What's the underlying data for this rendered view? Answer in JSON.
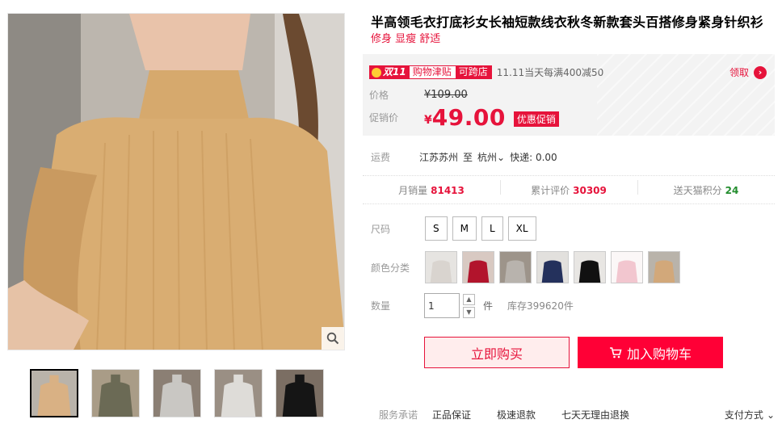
{
  "product": {
    "title": "半高领毛衣打底衫女长袖短款线衣秋冬新款套头百搭修身紧身针织衫",
    "subtitle": "修身 显瘦 舒适"
  },
  "promo": {
    "badge_mark": "双11",
    "badge_text": "购物津贴",
    "badge_tag": "可跨店",
    "text": "11.11当天每满400减50",
    "claim_label": "领取",
    "claim_icon": "chevron-right-circle-icon"
  },
  "price": {
    "list_label": "价格",
    "list_value": "¥109.00",
    "sale_label": "促销价",
    "currency": "¥",
    "sale_value": "49.00",
    "sale_tag": "优惠促销"
  },
  "shipping": {
    "label": "运费",
    "from": "江苏苏州",
    "to_word": "至",
    "to": "杭州",
    "method": "快递: 0.00"
  },
  "stats": {
    "monthly_label": "月销量",
    "monthly_value": "81413",
    "reviews_label": "累计评价",
    "reviews_value": "30309",
    "points_label": "送天猫积分",
    "points_value": "24"
  },
  "options": {
    "size_label": "尺码",
    "sizes": [
      "S",
      "M",
      "L",
      "XL"
    ],
    "color_label": "颜色分类",
    "qty_label": "数量",
    "qty_value": "1",
    "unit": "件",
    "stock": "库存399620件"
  },
  "actions": {
    "buy_now": "立即购买",
    "add_cart": "加入购物车"
  },
  "services": {
    "label": "服务承诺",
    "items": [
      "正品保证",
      "极速退款",
      "七天无理由退换"
    ],
    "payment": "支付方式"
  },
  "colors": {
    "accent": "#e6133b",
    "cart_button": "#ff0036",
    "green": "#238d2e",
    "swatches": [
      "#d9d4cf",
      "#b2142c",
      "#b8b3ad",
      "#24315c",
      "#111111",
      "#f2c6cf",
      "#d2a87a"
    ]
  },
  "thumbnails": [
    "#d9b184",
    "#6b6a55",
    "#c9c7c3",
    "#dedcd8",
    "#151515"
  ]
}
